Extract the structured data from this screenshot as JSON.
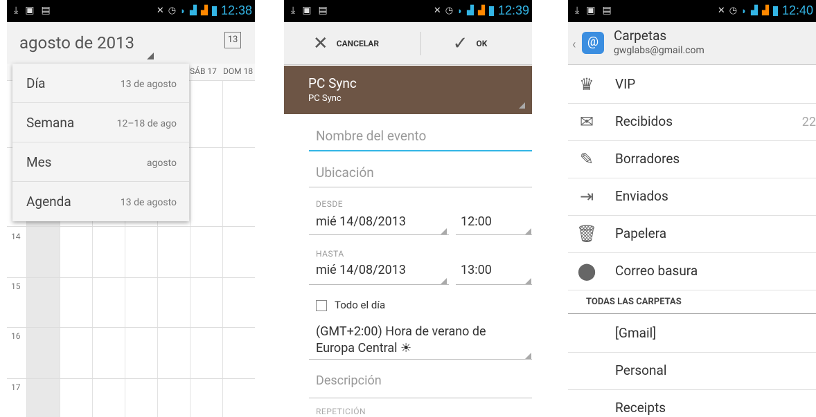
{
  "status": {
    "time1": "12:38",
    "time2": "12:39",
    "time3": "12:40"
  },
  "calendar": {
    "title": "agosto de 2013",
    "today_icon": "13",
    "day_headers": [
      "SÁB 17",
      "DOM 18"
    ],
    "hours": [
      "14",
      "15",
      "16",
      "17"
    ],
    "views": [
      {
        "label": "Día",
        "detail": "13 de agosto"
      },
      {
        "label": "Semana",
        "detail": "12–18 de ago"
      },
      {
        "label": "Mes",
        "detail": "agosto"
      },
      {
        "label": "Agenda",
        "detail": "13 de agosto"
      }
    ]
  },
  "event": {
    "cancel_label": "CANCELAR",
    "ok_label": "OK",
    "calendar_name": "PC Sync",
    "calendar_account": "PC Sync",
    "name_placeholder": "Nombre del evento",
    "location_placeholder": "Ubicación",
    "from_label": "DESDE",
    "from_date": "mié 14/08/2013",
    "from_time": "12:00",
    "to_label": "HASTA",
    "to_date": "mié 14/08/2013",
    "to_time": "13:00",
    "all_day_label": "Todo el día",
    "timezone": "(GMT+2:00) Hora de verano de Europa Central ☀",
    "description_placeholder": "Descripción",
    "repeat_label": "REPETICIÓN"
  },
  "mail": {
    "title": "Carpetas",
    "account": "gwglabs@gmail.com",
    "folders": [
      {
        "label": "VIP",
        "icon": "crown-icon",
        "count": ""
      },
      {
        "label": "Recibidos",
        "icon": "envelope-icon",
        "count": "22"
      },
      {
        "label": "Borradores",
        "icon": "drafts-icon",
        "count": ""
      },
      {
        "label": "Enviados",
        "icon": "sent-icon",
        "count": ""
      },
      {
        "label": "Papelera",
        "icon": "trash-icon",
        "count": ""
      },
      {
        "label": "Correo basura",
        "icon": "spam-icon",
        "count": ""
      }
    ],
    "all_folders_header": "TODAS LAS CARPETAS",
    "other_folders": [
      "[Gmail]",
      "Personal",
      "Receipts"
    ]
  }
}
